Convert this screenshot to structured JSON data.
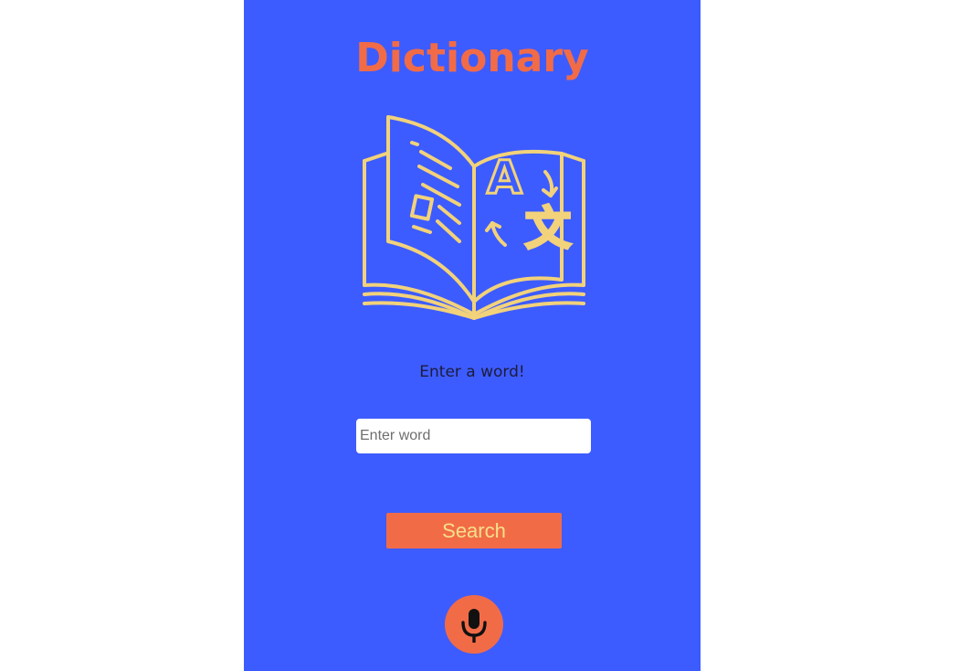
{
  "app": {
    "title": "Dictionary"
  },
  "illustration": {
    "icon": "open-book-translate-icon",
    "glyph_latin": "A",
    "glyph_cjk": "文"
  },
  "form": {
    "prompt": "Enter a word!",
    "input_value": "",
    "input_placeholder": "Enter word",
    "search_label": "Search",
    "mic_icon": "microphone-icon"
  },
  "colors": {
    "background": "#3d5cff",
    "accent": "#f26b47",
    "illustration": "#f2d27a",
    "button_text": "#f6e08a"
  }
}
